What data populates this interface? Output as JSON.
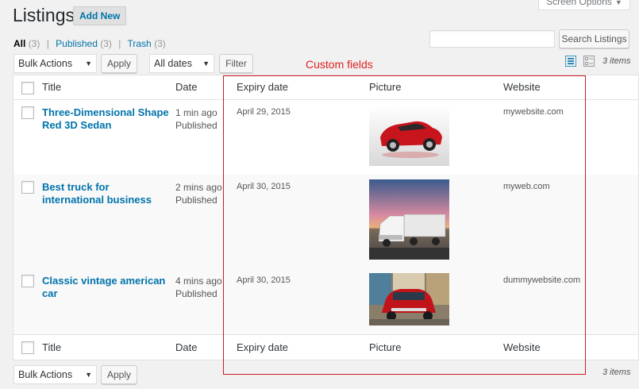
{
  "header": {
    "title": "Listings",
    "add_new": "Add New",
    "screen_options": "Screen Options"
  },
  "views": {
    "all": "All",
    "all_count": "(3)",
    "published": "Published",
    "published_count": "(3)",
    "trash": "Trash",
    "trash_count": "(3)",
    "separator": "|"
  },
  "search": {
    "value": "",
    "button": "Search Listings"
  },
  "toolbar": {
    "bulk_actions": "Bulk Actions",
    "apply": "Apply",
    "all_dates": "All dates",
    "filter": "Filter",
    "items_count": "3 items"
  },
  "annotation": {
    "label": "Custom fields",
    "color": "#d11b1b"
  },
  "columns": {
    "title": "Title",
    "date": "Date",
    "expiry": "Expiry date",
    "picture": "Picture",
    "website": "Website"
  },
  "rows": [
    {
      "title": "Three-Dimensional Shape Red 3D Sedan",
      "date_ago": "1 min ago",
      "status": "Published",
      "expiry": "April 29, 2015",
      "website": "mywebsite.com",
      "picture": "red-car-icon"
    },
    {
      "title": "Best truck for international business",
      "date_ago": "2 mins ago",
      "status": "Published",
      "expiry": "April 30, 2015",
      "website": "myweb.com",
      "picture": "truck-icon"
    },
    {
      "title": "Classic vintage american car",
      "date_ago": "4 mins ago",
      "status": "Published",
      "expiry": "April 30, 2015",
      "website": "dummywebsite.com",
      "picture": "vintage-car-icon"
    }
  ],
  "colors": {
    "link": "#0073aa",
    "annotation": "#e02020"
  }
}
